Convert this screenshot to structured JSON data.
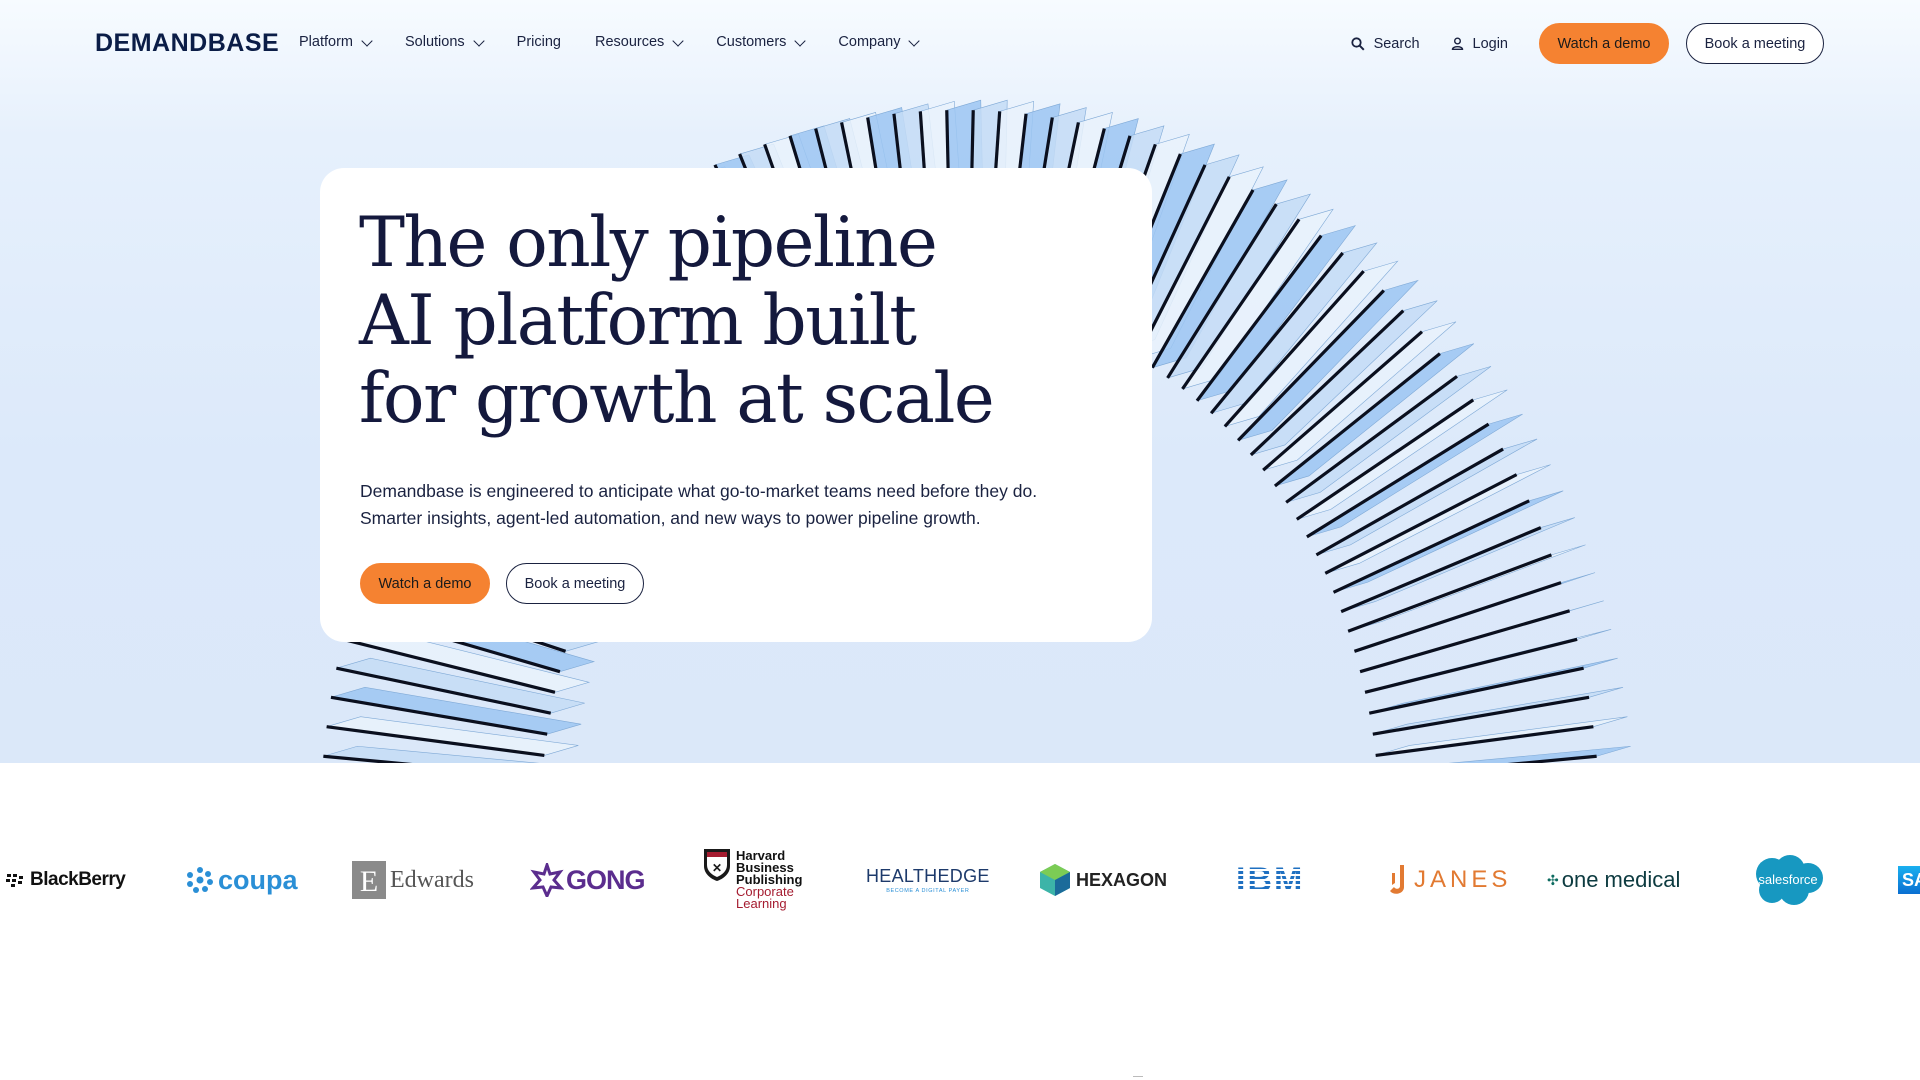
{
  "brand": {
    "logo_text": "DEMANDBASE",
    "accent_color": "#f58231",
    "text_color": "#0b1d47",
    "hero_bg_color": "#dce9fa"
  },
  "nav": {
    "menu": [
      {
        "label": "Platform",
        "has_dropdown": true
      },
      {
        "label": "Solutions",
        "has_dropdown": true
      },
      {
        "label": "Pricing",
        "has_dropdown": false
      },
      {
        "label": "Resources",
        "has_dropdown": true
      },
      {
        "label": "Customers",
        "has_dropdown": true
      },
      {
        "label": "Company",
        "has_dropdown": true
      }
    ],
    "search_label": "Search",
    "search_icon": "search-icon",
    "login_label": "Login",
    "login_icon": "user-icon",
    "demo_button": "Watch a demo",
    "meeting_button": "Book a meeting"
  },
  "hero": {
    "headline_lines": [
      "The only pipeline",
      "AI platform built",
      "for growth at scale"
    ],
    "subtitle_lines": [
      "Demandbase is engineered to anticipate what go-to-market teams need before they do.",
      "Smarter insights, agent-led automation, and new ways to power pipeline growth."
    ],
    "demo_button": "Watch a demo",
    "meeting_button": "Book a meeting"
  },
  "customer_logos": {
    "blackberry": "BlackBerry",
    "coupa": "coupa",
    "edwards": "Edwards",
    "gong": "GONG",
    "hbp_lines": [
      "Harvard",
      "Business",
      "Publishing",
      "Corporate",
      "Learning"
    ],
    "healthedge": "HEALTHEDGE",
    "healthedge_tagline": "BECOME A DIGITAL PAYER",
    "hexagon": "HEXAGON",
    "ibm": "IBM",
    "janes": "JANES",
    "onemedical": "one medical",
    "salesforce": "salesforce",
    "sap": "SA"
  }
}
